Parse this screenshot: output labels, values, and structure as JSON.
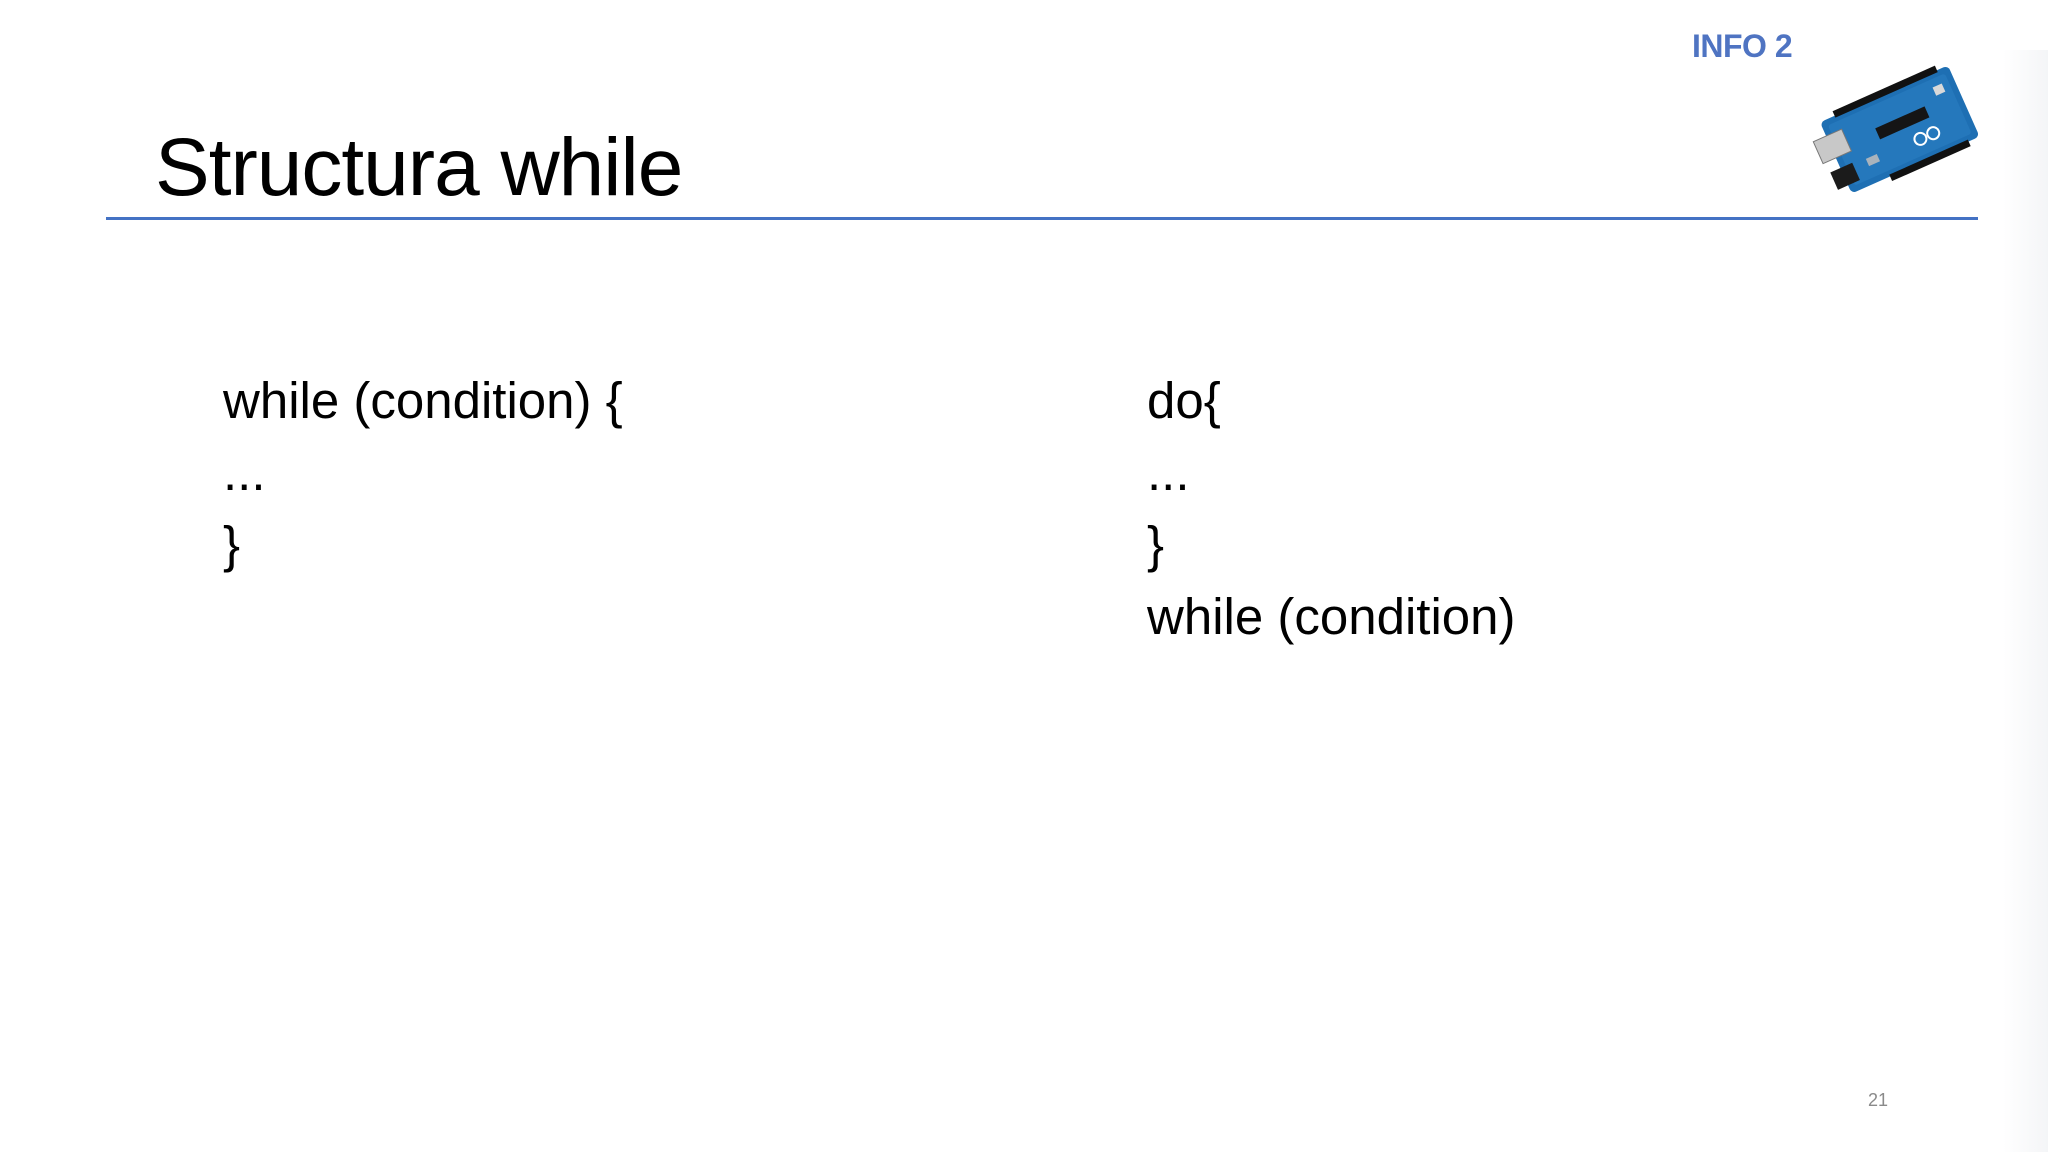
{
  "header": {
    "badge": "INFO 2",
    "board_icon": "arduino-board-icon"
  },
  "slide": {
    "title": "Structura while",
    "accent_color": "#4472c4",
    "badge_color": "#4f74c2"
  },
  "content": {
    "left_code": [
      "while (condition) {",
      "...",
      "}"
    ],
    "right_code": [
      "do{",
      "...",
      "}",
      "while (condition)"
    ]
  },
  "footer": {
    "page_number": "21"
  }
}
